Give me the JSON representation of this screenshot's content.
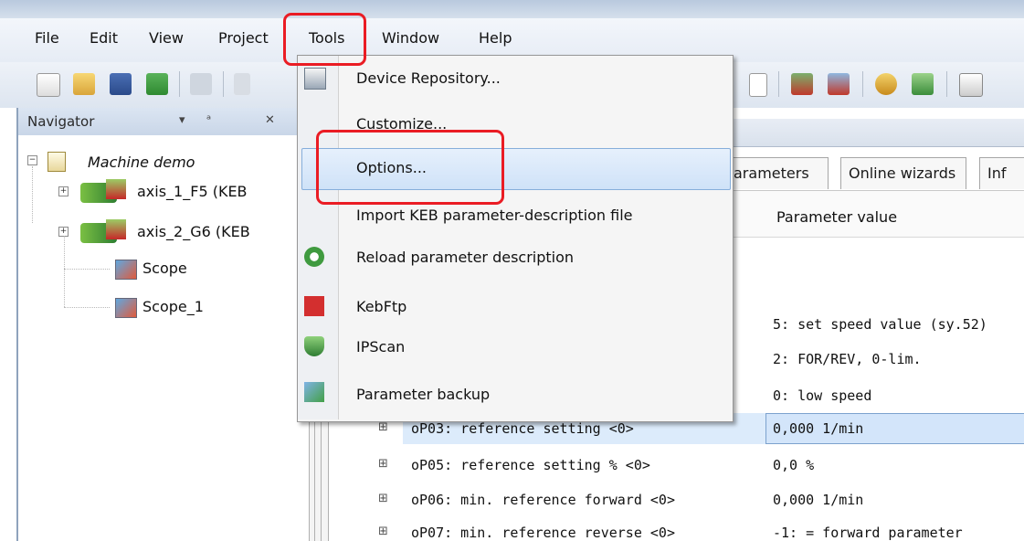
{
  "menubar": {
    "items": [
      "File",
      "Edit",
      "View",
      "Project",
      "Tools",
      "Window",
      "Help"
    ],
    "mnemonics": [
      "F",
      "E",
      "V",
      "P",
      "T",
      "W",
      "H"
    ]
  },
  "navigator": {
    "title": "Navigator",
    "pin_glyph": "▾ 𝌆 ✕",
    "root": "Machine demo",
    "items": [
      "axis_1_F5 (KEB",
      "axis_2_G6 (KEB",
      "Scope",
      "Scope_1"
    ]
  },
  "tools_menu": {
    "items": [
      {
        "label": "Device Repository...",
        "icon": "repository-icon"
      },
      {
        "label": "Customize...",
        "icon": ""
      },
      {
        "label": "Options...",
        "icon": ""
      },
      {
        "label": "Import KEB parameter-description file",
        "icon": ""
      },
      {
        "label": "Reload parameter description",
        "icon": "reload-icon"
      },
      {
        "label": "KebFtp",
        "icon": "kebftp-icon"
      },
      {
        "label": "IPScan",
        "icon": "ipscan-icon"
      },
      {
        "label": "Parameter backup",
        "icon": "backup-icon"
      }
    ],
    "highlighted": "Options..."
  },
  "tabs": [
    "arameters",
    "Online wizards",
    "Inf"
  ],
  "column_header": "Parameter value",
  "parameters": {
    "values_only": [
      "5: set speed value (sy.52)",
      "2: FOR/REV, 0-lim.",
      "0: low speed"
    ],
    "rows": [
      {
        "name": "oP03: reference setting <0>",
        "value": "0,000 1/min"
      },
      {
        "name": "oP05: reference setting % <0>",
        "value": "0,0 %"
      },
      {
        "name": "oP06: min. reference forward <0>",
        "value": "0,000 1/min"
      },
      {
        "name": "oP07: min. reference reverse <0>",
        "value": "-1: = forward parameter"
      }
    ]
  },
  "colors": {
    "accent": "#86aedb",
    "highlight_annotation": "#ea1c24",
    "selection": "#dcebfb"
  }
}
